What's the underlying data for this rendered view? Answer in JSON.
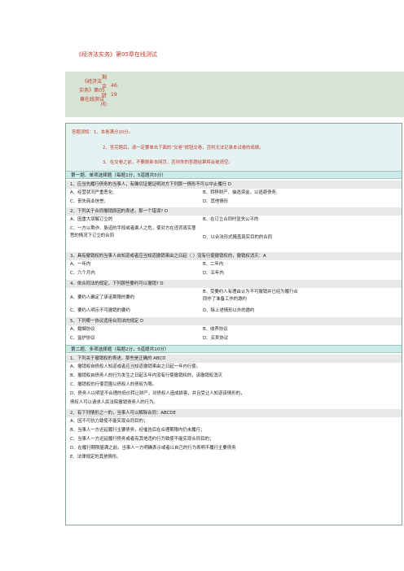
{
  "page": {
    "title": "《经济法实务》第05章在线测试"
  },
  "info": {
    "name_lines": [
      "《经济法",
      "实务》第05",
      "章在线测试"
    ],
    "remaining_label_chars": [
      "剩",
      "余",
      "时",
      "间:"
    ],
    "time_lines": [
      "46:",
      "19"
    ]
  },
  "notice": {
    "lines": [
      "答题须知：1、本卷满分20分。",
      "2、答完题后，请一定要单击下面的“交卷”按钮交卷，否则无法记录本试卷的成绩。",
      "3、在交卷之前，不要刷新本网页，否则你的答题结果将会被清空。"
    ]
  },
  "sections": [
    {
      "header": "第一题、单项选择题（每题1分，5道题共5分）"
    },
    {
      "header": "第二题、多项选择题（每题2分，5道题共10分）"
    }
  ],
  "single_choice": [
    {
      "title": "1、应当先履行债务的当事人，有确切证据证明对方下列那一情形不可以中止履行 D",
      "options": [
        "A、经营状况严重恶化;",
        "B、转移财产、抽逃资金，以逃避债务;",
        "C、丧失商业信誉;",
        "D、其他情形"
      ]
    },
    {
      "title": "2、下列关于合同撤销原因的表述，那一个错误? D",
      "options": [
        "A、因重大误解订立的",
        "B、在订立合同时显失公平的",
        "C、一方以欺诈、胁迫的手段或者乘人之危，使对方在违背真实意思的情况下订立的合同",
        "D、以合法形式掩盖真实目的的合同"
      ]
    },
    {
      "title": "3、具有撤销权的当事人自知道或者应当知道撤销事由之日起（ ）没有行使撤销权的，撤销权消灭：A",
      "options": [
        "A、一年内",
        "B、二年内",
        "C、六个月内",
        "D、五年内"
      ]
    },
    {
      "title": "4、依合同法的规定，下列那些要约可以撤销? D",
      "options": [
        "A、要约人确定了承诺期限的要约",
        "B、受要约人有理由认为不可撤销并已经为履行合同作了准备工作的邀约",
        "C、要约人明示不可撤销的要约",
        "D、除上述情形以外的邀约"
      ]
    },
    {
      "title": "5、下列哪一协议适用合同法的规定 D",
      "options": [
        "A、婚姻协议",
        "B、收养协议",
        "C、监护协议",
        "D、买卖协议"
      ]
    }
  ],
  "multi_choice": [
    {
      "title": "1、下列关于撤销权的表述，那些是正确的 ABCD",
      "options": [
        "A、撤销权自债权人知道或者应当知道撤销事由之日起一年内行使。",
        "B、撤销权自债务人的行为发生之日起五年内没有行使撤销权的，该撤销权消灭",
        "C、撤销权的行使范围以债权人的债权为限。",
        "D、债务人以明显不合理的低价转让财产，对债权人造成损害，并且受让人知道该情形的，",
        "债权人可以请求人民法院撤销债务人的行为。"
      ]
    },
    {
      "title": "2、有下列情形之一的，当事人可以解除合同：ABCDE",
      "options": [
        "A、因不可抗力致使不能实现合同目的；",
        "B、当事人一方迟延履行主要债务，经催告后在合理期限内仍未履行；",
        "C、当事人一方迟延履行债务或者有其他违约行为致使不能实现合同目的；",
        "D、在履行期限届满之前，当事人一方明确表示或者以自己的行为表明不履行主要债务",
        "E、法律规定的其他情形。"
      ]
    }
  ]
}
